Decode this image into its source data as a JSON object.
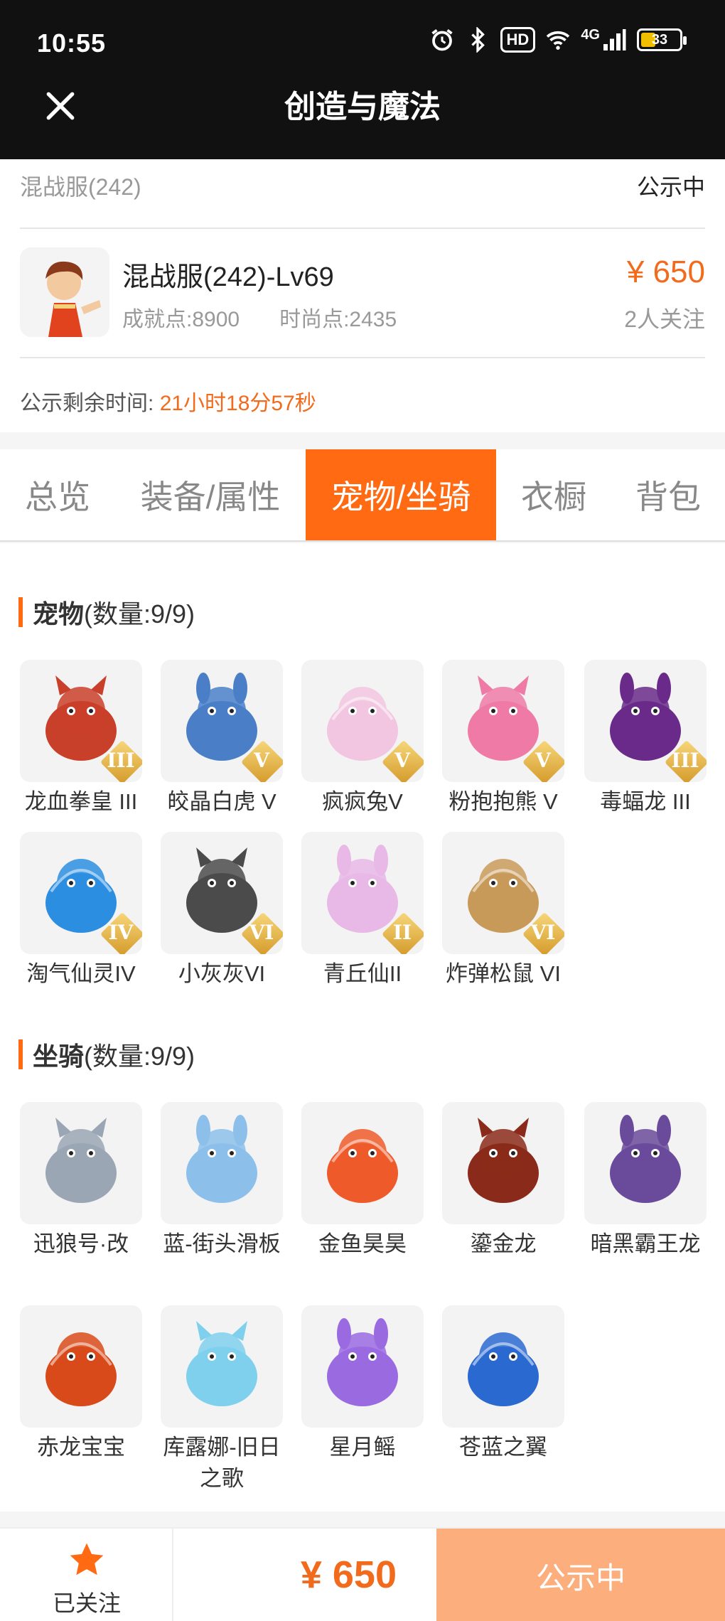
{
  "status_bar": {
    "time": "10:55",
    "hd_label": "HD",
    "network_label": "4G",
    "battery": "33"
  },
  "header": {
    "title": "创造与魔法"
  },
  "summary": {
    "server": "混战服(242)",
    "status": "公示中",
    "char_title": "混战服(242)-Lv69",
    "achievement": "成就点:8900",
    "fashion": "时尚点:2435",
    "price": "¥ 650",
    "followers": "2人关注",
    "remain_label": "公示剩余时间:",
    "remain_value": "21小时18分57秒"
  },
  "tabs": [
    {
      "label": "总览",
      "active": false
    },
    {
      "label": "装备/属性",
      "active": false
    },
    {
      "label": "宠物/坐骑",
      "active": true
    },
    {
      "label": "衣橱",
      "active": false
    },
    {
      "label": "背包",
      "active": false
    }
  ],
  "pets": {
    "title": "宠物",
    "count": "(数量:9/9)",
    "items": [
      {
        "name": "龙血拳皇 III",
        "rank": "III",
        "icon": "red-dragon-fighter-icon",
        "color": "#c9402a"
      },
      {
        "name": "皎晶白虎 V",
        "rank": "V",
        "icon": "white-tiger-icon",
        "color": "#4a7fc8"
      },
      {
        "name": "疯疯兔V",
        "rank": "V",
        "icon": "pink-rabbit-icon",
        "color": "#f2c6e0"
      },
      {
        "name": "粉抱抱熊 V",
        "rank": "V",
        "icon": "pink-bear-icon",
        "color": "#ef7aa6"
      },
      {
        "name": "毒蝠龙 III",
        "rank": "III",
        "icon": "purple-bat-dragon-icon",
        "color": "#6a2a8a"
      },
      {
        "name": "淘气仙灵IV",
        "rank": "IV",
        "icon": "blue-sprite-icon",
        "color": "#2c8ee0"
      },
      {
        "name": "小灰灰VI",
        "rank": "VI",
        "icon": "grey-wolf-pup-icon",
        "color": "#4b4b4b"
      },
      {
        "name": "青丘仙II",
        "rank": "II",
        "icon": "fox-fairy-icon",
        "color": "#e8b8e6"
      },
      {
        "name": "炸弹松鼠 VI",
        "rank": "VI",
        "icon": "bomb-squirrel-icon",
        "color": "#c89a5a"
      }
    ]
  },
  "mounts": {
    "title": "坐骑",
    "count": "(数量:9/9)",
    "items": [
      {
        "name": "迅狼号·改",
        "icon": "mecha-wolf-icon",
        "color": "#9aa6b4"
      },
      {
        "name": "蓝-街头滑板",
        "icon": "skateboard-icon",
        "color": "#8cc0ea"
      },
      {
        "name": "金鱼昊昊",
        "icon": "goldfish-icon",
        "color": "#ef5a2a"
      },
      {
        "name": "鎏金龙",
        "icon": "gold-dragon-icon",
        "color": "#8a2a1a"
      },
      {
        "name": "暗黑霸王龙",
        "icon": "dark-trex-icon",
        "color": "#6a4a9a"
      },
      {
        "name": "赤龙宝宝",
        "icon": "red-baby-dragon-icon",
        "color": "#d84a1a"
      },
      {
        "name": "库露娜-旧日之歌",
        "icon": "kuluna-sheep-icon",
        "color": "#7fd0ec"
      },
      {
        "name": "星月鳐",
        "icon": "star-ray-icon",
        "color": "#9a6ae0"
      },
      {
        "name": "苍蓝之翼",
        "icon": "blue-wing-dragon-icon",
        "color": "#2a6ad0"
      }
    ]
  },
  "bottom": {
    "follow_label": "已关注",
    "price": "¥ 650",
    "status": "公示中"
  },
  "colors": {
    "accent": "#ff6a13",
    "price": "#f26b1d",
    "status_button": "#fcae7c"
  }
}
